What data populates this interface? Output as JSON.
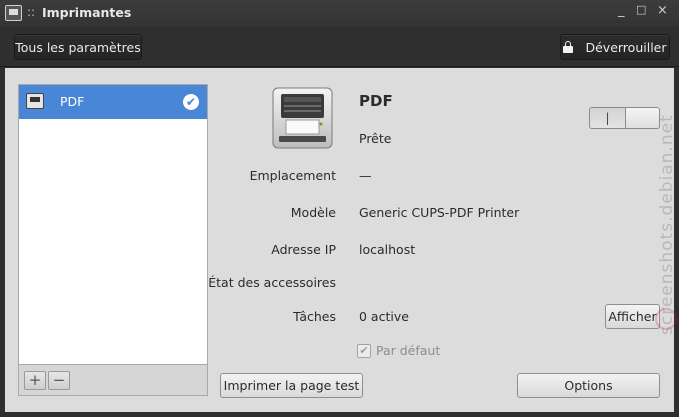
{
  "window": {
    "title": "Imprimantes",
    "title_separator": "::",
    "minimize_glyph": "_",
    "maximize_glyph": "□",
    "close_glyph": "×"
  },
  "header": {
    "all_settings_label": "Tous les paramètres",
    "unlock_label": "Déverrouiller"
  },
  "printers": [
    {
      "name": "PDF",
      "is_default": true
    }
  ],
  "list_toolbar": {
    "add": "+",
    "remove": "−"
  },
  "details": {
    "name": "PDF",
    "status": "Prête",
    "toggle_on_glyph": "|",
    "rows": {
      "location": {
        "label": "Emplacement",
        "value": "—"
      },
      "model": {
        "label": "Modèle",
        "value": "Generic CUPS-PDF Printer"
      },
      "ip": {
        "label": "Adresse IP",
        "value": "localhost"
      },
      "accessories": {
        "label": "État des accessoires",
        "value": ""
      },
      "jobs": {
        "label": "Tâches",
        "value": "0 active"
      }
    },
    "show_button": "Afficher",
    "default_checkbox": "Par défaut",
    "default_checked": true,
    "test_page_button": "Imprimer la page test",
    "options_button": "Options"
  },
  "watermark": "screenshots.debian.net"
}
